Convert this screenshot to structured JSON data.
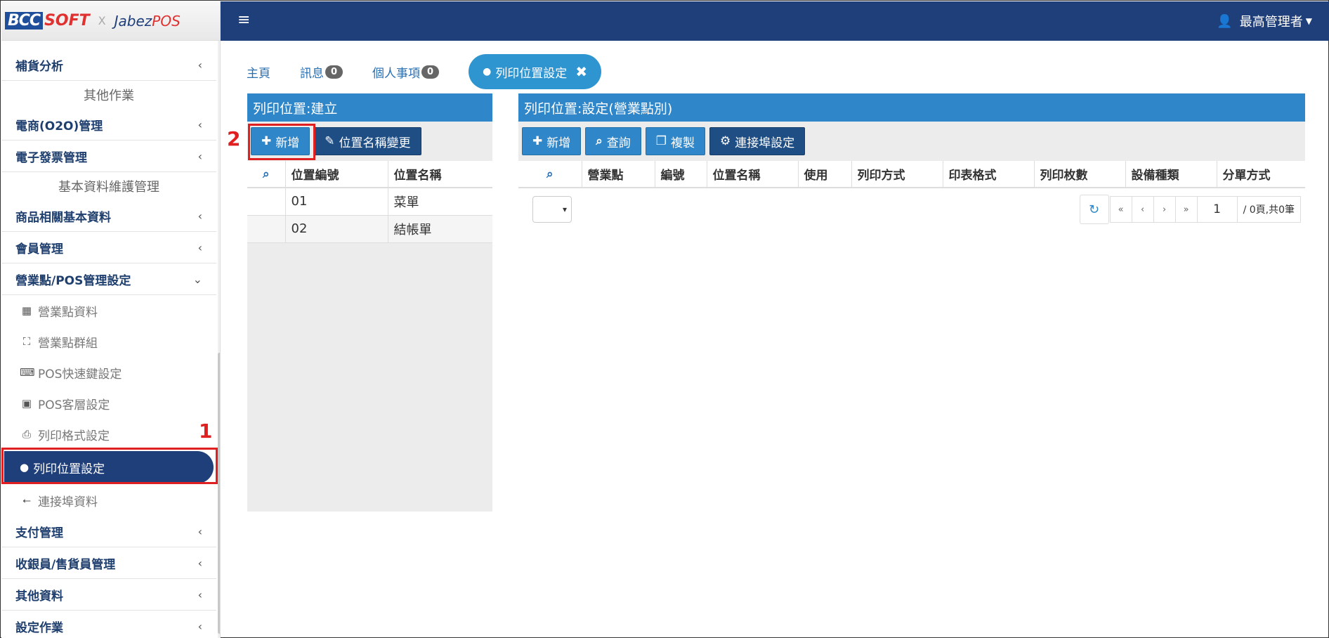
{
  "logo": {
    "bcc": "BCC",
    "soft": "SOFT",
    "x": "X",
    "jabez": "Jabez",
    "pos": "POS"
  },
  "sidebar": {
    "items": [
      {
        "label": "補貨分析",
        "type": "group"
      },
      {
        "label": "其他作業",
        "type": "header"
      },
      {
        "label": "電商(O2O)管理",
        "type": "group"
      },
      {
        "label": "電子發票管理",
        "type": "group"
      },
      {
        "label": "基本資料維護管理",
        "type": "header"
      },
      {
        "label": "商品相關基本資料",
        "type": "group"
      },
      {
        "label": "會員管理",
        "type": "group"
      },
      {
        "label": "營業點/POS管理設定",
        "type": "group-open"
      },
      {
        "label": "營業點資料",
        "type": "sub",
        "icon": "building-icon"
      },
      {
        "label": "營業點群組",
        "type": "sub",
        "icon": "group-icon"
      },
      {
        "label": "POS快速鍵設定",
        "type": "sub",
        "icon": "keyboard-icon"
      },
      {
        "label": "POS客層設定",
        "type": "sub",
        "icon": "id-card-icon"
      },
      {
        "label": "列印格式設定",
        "type": "sub",
        "icon": "printer-icon"
      },
      {
        "label": "列印位置設定",
        "type": "sub-active",
        "icon": "map-marker-icon"
      },
      {
        "label": "連接埠資料",
        "type": "sub",
        "icon": "usb-icon"
      },
      {
        "label": "支付管理",
        "type": "group"
      },
      {
        "label": "收銀員/售貨員管理",
        "type": "group"
      },
      {
        "label": "其他資料",
        "type": "group"
      },
      {
        "label": "設定作業",
        "type": "group"
      }
    ]
  },
  "annotations": {
    "step1": "1",
    "step2": "2"
  },
  "topbar": {
    "user": "最高管理者"
  },
  "tabs": {
    "home": "主頁",
    "messages": "訊息",
    "messages_count": "0",
    "personal": "個人事項",
    "personal_count": "0",
    "active": "列印位置設定"
  },
  "left_panel": {
    "title": "列印位置:建立",
    "buttons": {
      "add": "新增",
      "rename": "位置名稱變更"
    },
    "columns": [
      "位置編號",
      "位置名稱"
    ],
    "rows": [
      {
        "code": "01",
        "name": "菜單"
      },
      {
        "code": "02",
        "name": "結帳單"
      }
    ]
  },
  "right_panel": {
    "title": "列印位置:設定(營業點別)",
    "buttons": {
      "add": "新增",
      "query": "查詢",
      "copy": "複製",
      "port": "連接埠設定"
    },
    "columns": [
      "營業點",
      "編號",
      "位置名稱",
      "使用",
      "列印方式",
      "印表格式",
      "列印枚數",
      "設備種類",
      "分單方式"
    ],
    "pager": {
      "first": "«",
      "prev": "‹",
      "next": "›",
      "last": "»",
      "page": "1",
      "info": "/ 0頁,共0筆"
    }
  },
  "colors": {
    "navy": "#1f3f7a",
    "blue": "#2f86c8",
    "tab_active": "#2f95d0",
    "highlight": "#e02020"
  }
}
